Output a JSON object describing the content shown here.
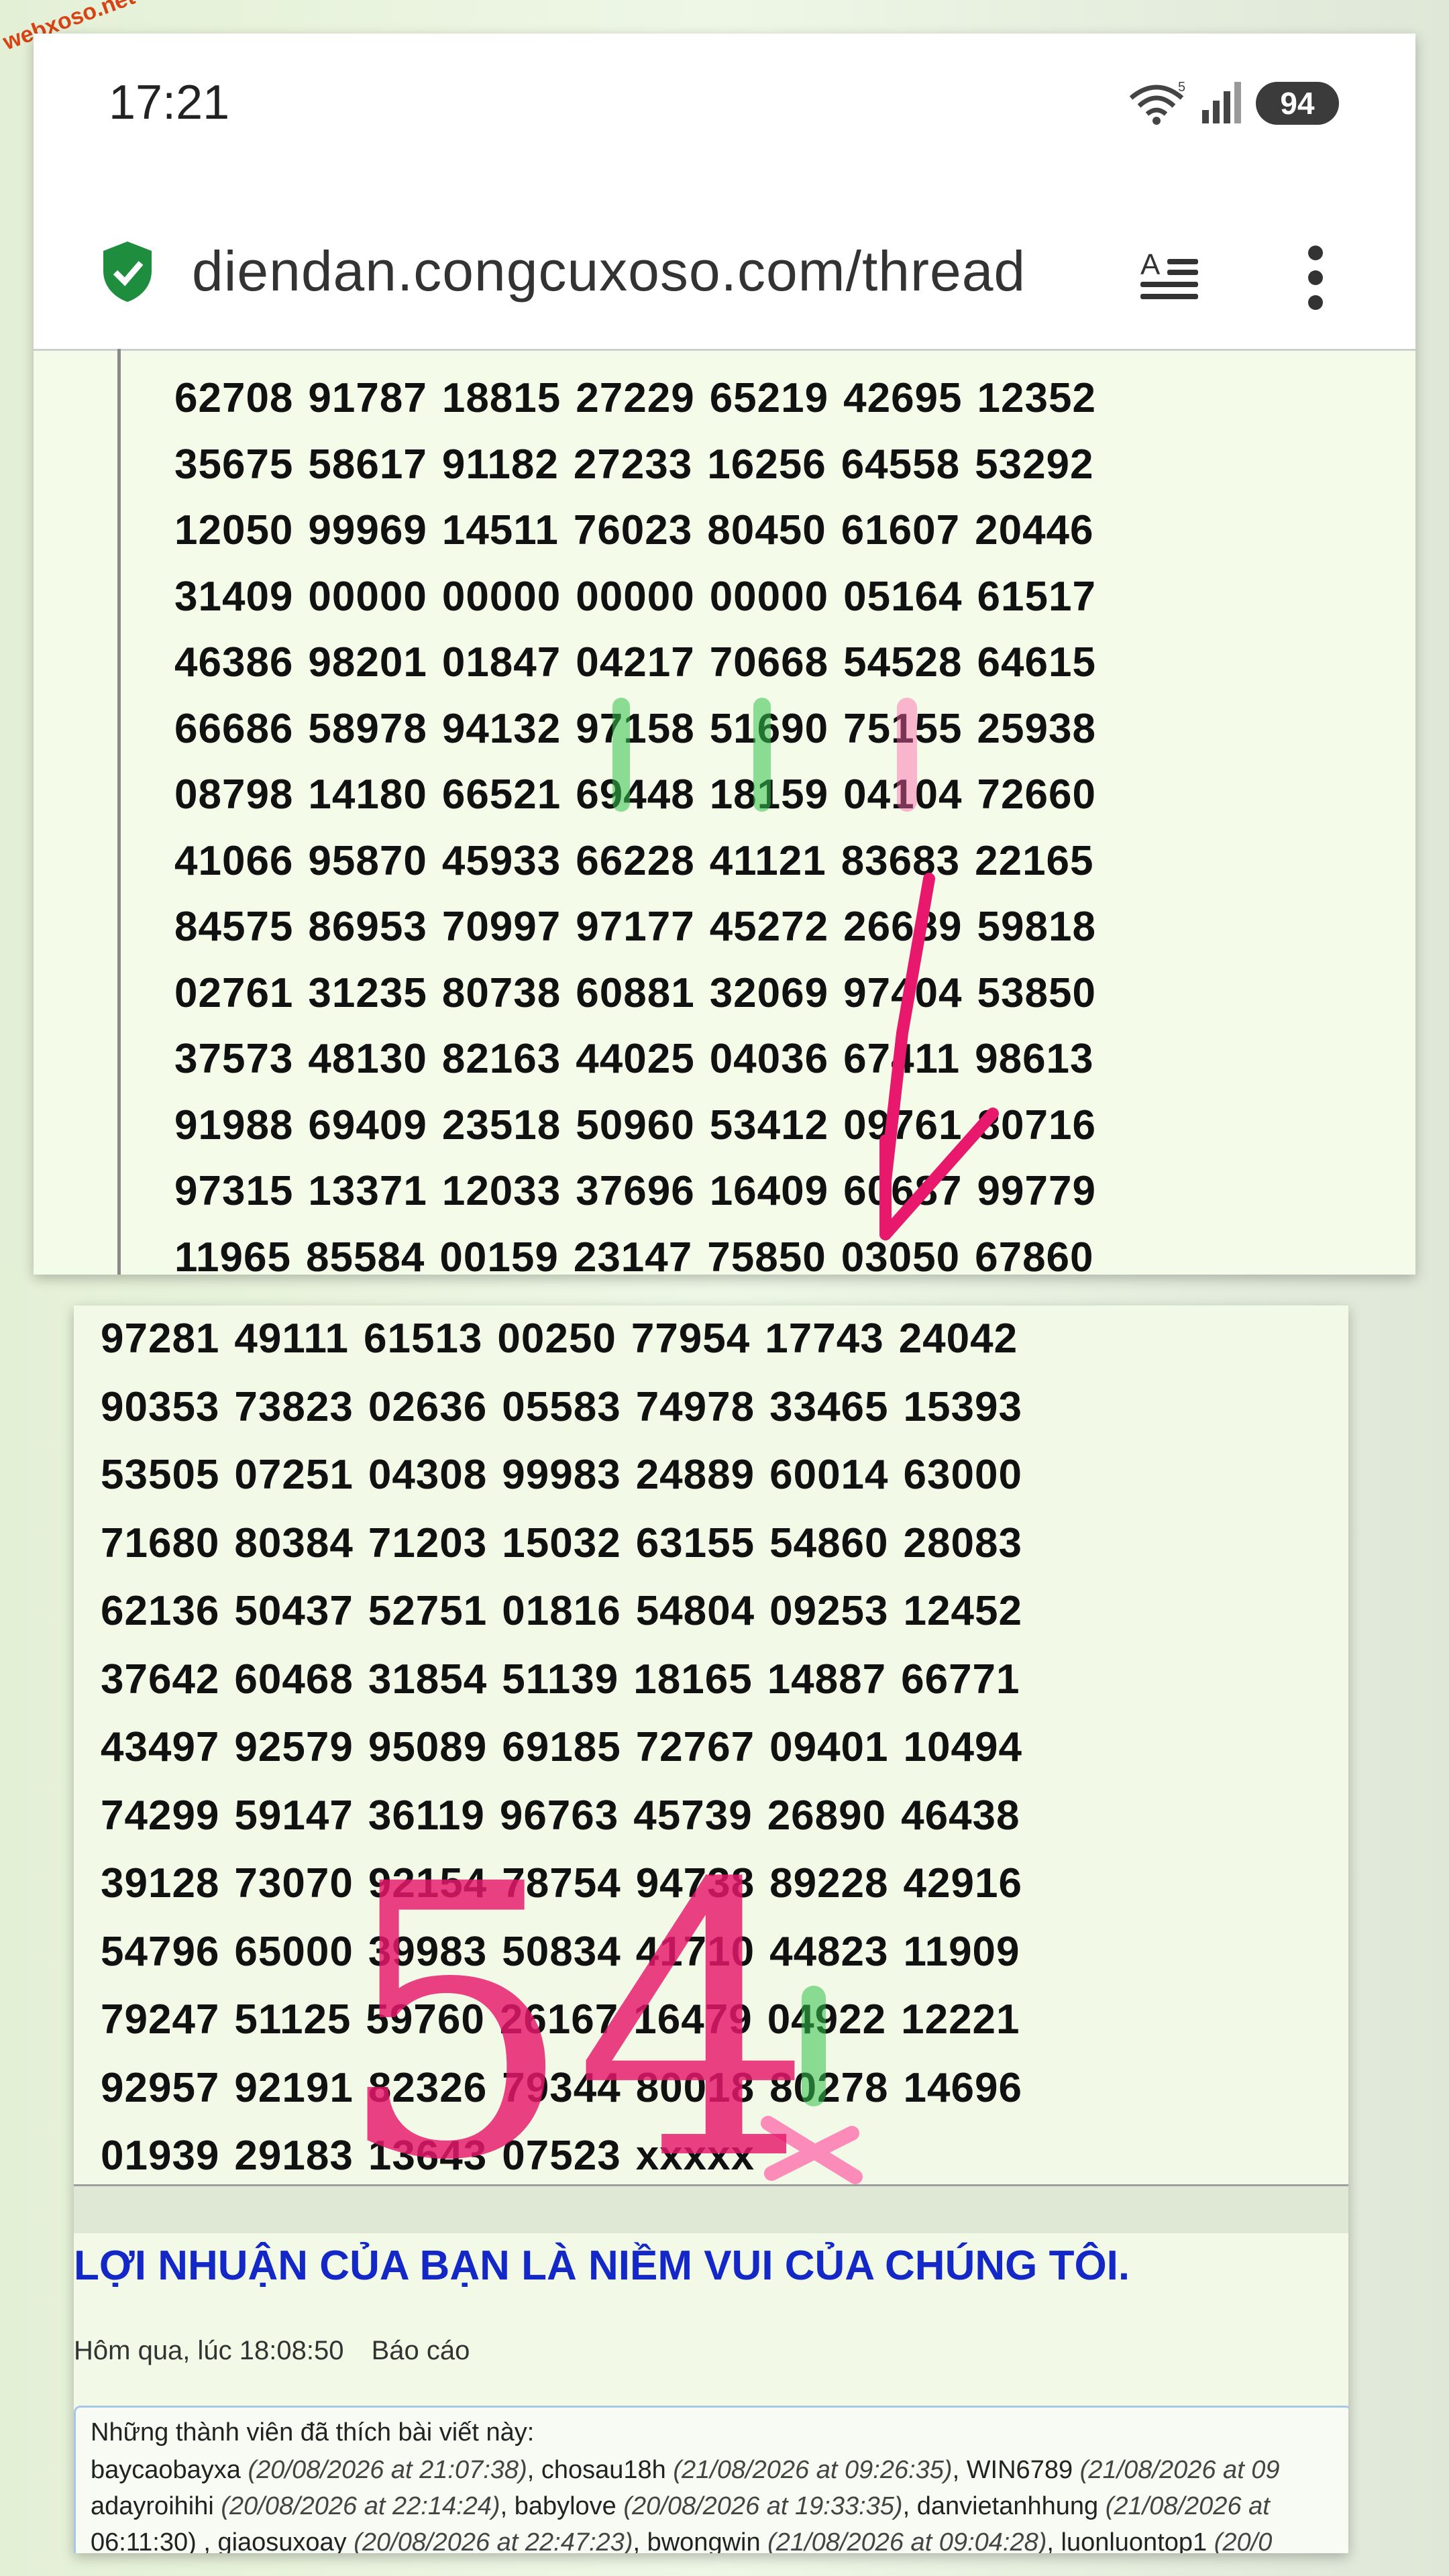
{
  "watermark": "webxoso.net",
  "status": {
    "time": "17:21",
    "wifi_badge": "5",
    "battery": "94"
  },
  "browser": {
    "url": "diendan.congcuxoso.com/thread",
    "icons": [
      "shield-check-icon",
      "reader-mode-icon",
      "more-vert-icon"
    ]
  },
  "top_rows": [
    [
      "62708",
      "91787",
      "18815",
      "27229",
      "65219",
      "42695",
      "12352"
    ],
    [
      "35675",
      "58617",
      "91182",
      "27233",
      "16256",
      "64558",
      "53292"
    ],
    [
      "12050",
      "99969",
      "14511",
      "76023",
      "80450",
      "61607",
      "20446"
    ],
    [
      "31409",
      "00000",
      "00000",
      "00000",
      "00000",
      "05164",
      "61517"
    ],
    [
      "46386",
      "98201",
      "01847",
      "04217",
      "70668",
      "54528",
      "64615"
    ],
    [
      "66686",
      "58978",
      "94132",
      "97158",
      "51690",
      "75155",
      "25938"
    ],
    [
      "08798",
      "14180",
      "66521",
      "69448",
      "18159",
      "04104",
      "72660"
    ],
    [
      "41066",
      "95870",
      "45933",
      "66228",
      "41121",
      "83683",
      "22165"
    ],
    [
      "84575",
      "86953",
      "70997",
      "97177",
      "45272",
      "26689",
      "59818"
    ],
    [
      "02761",
      "31235",
      "80738",
      "60881",
      "32069",
      "97404",
      "53850"
    ],
    [
      "37573",
      "48130",
      "82163",
      "44025",
      "04036",
      "67411",
      "98613"
    ],
    [
      "91988",
      "69409",
      "23518",
      "50960",
      "53412",
      "09761",
      "80716"
    ],
    [
      "97315",
      "13371",
      "12033",
      "37696",
      "16409",
      "60687",
      "99779"
    ],
    [
      "11965",
      "85584",
      "00159",
      "23147",
      "75850",
      "03050",
      "67860"
    ]
  ],
  "bottom_rows": [
    [
      "97281",
      "49111",
      "61513",
      "00250",
      "77954",
      "17743",
      "24042"
    ],
    [
      "90353",
      "73823",
      "02636",
      "05583",
      "74978",
      "33465",
      "15393"
    ],
    [
      "53505",
      "07251",
      "04308",
      "99983",
      "24889",
      "60014",
      "63000"
    ],
    [
      "71680",
      "80384",
      "71203",
      "15032",
      "63155",
      "54860",
      "28083"
    ],
    [
      "62136",
      "50437",
      "52751",
      "01816",
      "54804",
      "09253",
      "12452"
    ],
    [
      "37642",
      "60468",
      "31854",
      "51139",
      "18165",
      "14887",
      "66771"
    ],
    [
      "43497",
      "92579",
      "95089",
      "69185",
      "72767",
      "09401",
      "10494"
    ],
    [
      "74299",
      "59147",
      "36119",
      "96763",
      "45739",
      "26890",
      "46438"
    ],
    [
      "39128",
      "73070",
      "92154",
      "78754",
      "94738",
      "89228",
      "42916"
    ],
    [
      "54796",
      "65000",
      "39983",
      "50834",
      "41710",
      "44823",
      "11909"
    ],
    [
      "79247",
      "51125",
      "59760",
      "26167",
      "16479",
      "04922",
      "12221"
    ],
    [
      "92957",
      "92191",
      "82326",
      "79344",
      "80018",
      "80278",
      "14696"
    ],
    [
      "01939",
      "29183",
      "13643",
      "07523",
      "xxxxx"
    ]
  ],
  "annotation_text": "54",
  "post": {
    "headline": "LỢI NHUẬN CỦA BẠN LÀ NIỀM VUI CỦA CHÚNG TÔI.",
    "date": "Hôm qua, lúc 18:08:50",
    "report": "Báo cáo",
    "likes_title": "Những thành viên đã thích bài viết này:",
    "likes_lines": [
      [
        {
          "name": "baycaobayxa",
          "time": "(20/08/2026 at 21:07:38)"
        },
        {
          "name": "chosau18h",
          "time": "(21/08/2026 at 09:26:35)"
        },
        {
          "name": "WIN6789",
          "time": "(21/08/2026 at 09"
        }
      ],
      [
        {
          "name": "adayroihihi",
          "time": "(20/08/2026 at 22:14:24)"
        },
        {
          "name": "babylove",
          "time": "(20/08/2026 at 19:33:35)"
        },
        {
          "name": "danvietanhhung",
          "time": "(21/08/2026 at"
        }
      ],
      [
        {
          "name": "06:11:30)",
          "time": ""
        },
        {
          "name": "giaosuxoay",
          "time": "(20/08/2026 at 22:47:23)"
        },
        {
          "name": "bwongwin",
          "time": "(21/08/2026 at 09:04:28)"
        },
        {
          "name": "luonluontop1",
          "time": "(20/0"
        }
      ]
    ]
  },
  "colors": {
    "highlight_green": "#33c24d",
    "highlight_pink": "#ff5fa8",
    "ink_pink": "#e8186c",
    "headline_blue": "#1428c8"
  }
}
